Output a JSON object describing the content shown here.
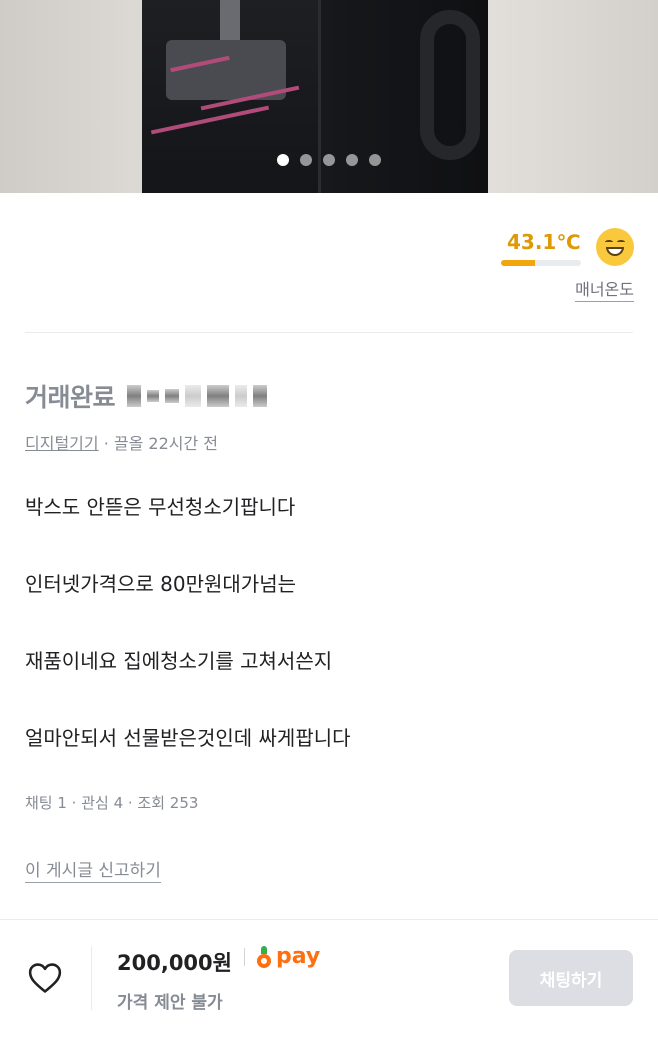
{
  "gallery": {
    "dot_count": 5,
    "active_index": 0
  },
  "seller": {
    "temperature": "43.1℃",
    "temperature_fraction": 0.43,
    "temperature_color": "#de9a05",
    "manner_label": "매너온도"
  },
  "post": {
    "status": "거래완료",
    "category": "디지털기기",
    "time_text": " · 끌올 22시간 전",
    "description": [
      "박스도  안뜯은 무선청소기팝니다",
      "인터넷가격으로 80만원대가넘는",
      "재품이네요  집에청소기를 고쳐서쓴지",
      "얼마안되서 선물받은것인데 싸게팝니다"
    ],
    "stats": "채팅 1 · 관심 4 · 조회 253",
    "report_label": "이 게시글 신고하기"
  },
  "bottom_bar": {
    "price": "200,000원",
    "pay_label": "pay",
    "negotiation": "가격 제안 불가",
    "chat_button": "채팅하기"
  },
  "colors": {
    "accent": "#ff6f0f",
    "pay_leaf": "#32b14a",
    "disabled_button": "#dcdee3"
  }
}
